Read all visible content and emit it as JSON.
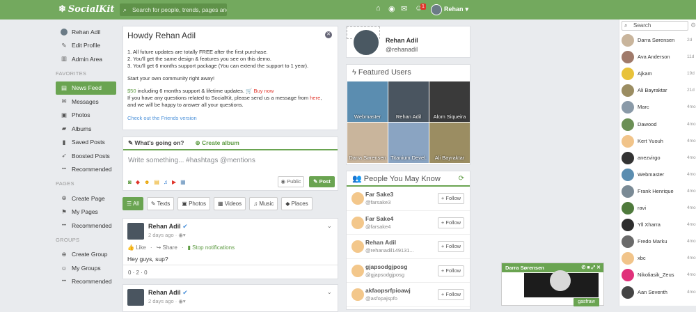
{
  "topbar": {
    "logo": "SocialKit",
    "search_placeholder": "Search for people, trends, pages and...",
    "notif_count": "1",
    "username": "Rehan"
  },
  "sidebar": {
    "user_items": [
      {
        "icon": "avatar",
        "label": "Rehan Adil"
      },
      {
        "icon": "pencil-icon",
        "label": "Edit Profile"
      },
      {
        "icon": "chart-icon",
        "label": "Admin Area"
      }
    ],
    "favorites_title": "FAVORITES",
    "favorites": [
      {
        "icon": "newsfeed-icon",
        "label": "News Feed",
        "active": true
      },
      {
        "icon": "comments-icon",
        "label": "Messages"
      },
      {
        "icon": "photo-icon",
        "label": "Photos"
      },
      {
        "icon": "folder-icon",
        "label": "Albums"
      },
      {
        "icon": "bookmark-icon",
        "label": "Saved Posts"
      },
      {
        "icon": "rocket-icon",
        "label": "Boosted Posts"
      },
      {
        "icon": "dots-icon",
        "label": "Recommended"
      }
    ],
    "pages_title": "PAGES",
    "pages": [
      {
        "icon": "plus-icon",
        "label": "Create Page"
      },
      {
        "icon": "flag-icon",
        "label": "My Pages"
      },
      {
        "icon": "dots-icon",
        "label": "Recommended"
      }
    ],
    "groups_title": "GROUPS",
    "groups": [
      {
        "icon": "plus-icon",
        "label": "Create Group"
      },
      {
        "icon": "users-icon",
        "label": "My Groups"
      },
      {
        "icon": "dots-icon",
        "label": "Recommended"
      }
    ]
  },
  "welcome": {
    "title": "Howdy Rehan Adil",
    "line1": "1. All future updates are totally FREE after the first purchase.",
    "line2": "2. You'll get the same design & features you see on this demo.",
    "line3": "3. You'll get 6 months support package (You can extend the support to 1 year).",
    "line4": "Start your own community right away!",
    "price": "$50",
    "price_text": " including 6 months support & lifetime updates. ",
    "buy": "Buy now",
    "q1": "If you have any questions related to SocialKit, please send us a message from ",
    "here": "here",
    "q1_end": ",",
    "q2": "and we will be happy to answer all your questions.",
    "friends_link": "Check out the Friends version"
  },
  "composer": {
    "tab_status": "What's going on?",
    "tab_album": "Create album",
    "placeholder": "Write something... #hashtags @mentions",
    "privacy": "Public",
    "post": "Post"
  },
  "filters": [
    "All",
    "Texts",
    "Photos",
    "Videos",
    "Music",
    "Places"
  ],
  "post": {
    "author": "Rehan Adil",
    "time": "2 days ago · ",
    "like": "Like",
    "share": "Share",
    "stop": "Stop notifications",
    "text": "Hey guys, sup?",
    "stats": "0 · 2 · 0"
  },
  "post2": {
    "author": "Rehan Adil",
    "time": "2 days ago · "
  },
  "profile": {
    "name": "Rehan Adil",
    "handle": "@rehanadil"
  },
  "featured": {
    "title": "Featured Users",
    "users": [
      {
        "name": "Webmaster",
        "color": "#5b8db0"
      },
      {
        "name": "Rehan Adil",
        "color": "#4a5560"
      },
      {
        "name": "Alom Siqueira",
        "color": "#3a3a3a"
      },
      {
        "name": "Darra Sørensen",
        "color": "#c9b59c"
      },
      {
        "name": "Titanium Devel.",
        "color": "#8aa4c2"
      },
      {
        "name": "Ali Bayraktar",
        "color": "#9b8d62"
      }
    ]
  },
  "pymk": {
    "title": "People You May Know",
    "follow": "Follow",
    "people": [
      {
        "name": "Far Sake3",
        "handle": "@farsake3"
      },
      {
        "name": "Far Sake4",
        "handle": "@farsake4"
      },
      {
        "name": "Rehan Adil",
        "handle": "@rehanadil149131..."
      },
      {
        "name": "gjapsodgjposg",
        "handle": "@gjapsodgjposg"
      },
      {
        "name": "akfaopsrfpioawj",
        "handle": "@asfopajspfo"
      }
    ]
  },
  "chat": {
    "search": "Search",
    "contacts": [
      {
        "name": "Darra Sørensen",
        "time": "2d",
        "color": "#c9b59c"
      },
      {
        "name": "Ava Anderson",
        "time": "11d",
        "color": "#a07a6a"
      },
      {
        "name": "Ajkam",
        "time": "19d",
        "color": "#e8c23a"
      },
      {
        "name": "Ali Bayraktar",
        "time": "21d",
        "color": "#9b8d62"
      },
      {
        "name": "Marc",
        "time": "4mo",
        "color": "#8a9aa8"
      },
      {
        "name": "Dawood",
        "time": "4mo",
        "color": "#6b8f55"
      },
      {
        "name": "Kert Yuouh",
        "time": "4mo",
        "color": "#f1c48a"
      },
      {
        "name": "anezvirgo",
        "time": "4mo",
        "color": "#333"
      },
      {
        "name": "Webmaster",
        "time": "4mo",
        "color": "#5b8db0"
      },
      {
        "name": "Frank Henrique",
        "time": "4mo",
        "color": "#7a8a95"
      },
      {
        "name": "ravi",
        "time": "4mo",
        "color": "#4f7a3c"
      },
      {
        "name": "Yll Xharra",
        "time": "4mo",
        "color": "#2e2e2e"
      },
      {
        "name": "Fredo Marku",
        "time": "4mo",
        "color": "#6a6a6a"
      },
      {
        "name": "xbc",
        "time": "4mo",
        "color": "#f1c48a"
      },
      {
        "name": "Nikoliasik_Zeus",
        "time": "4mo",
        "color": "#e0307a"
      },
      {
        "name": "Aan Seventh",
        "time": "4mo",
        "color": "#444"
      }
    ]
  },
  "popup": {
    "name": "Darra Sørensen",
    "sender": "gasfraw"
  }
}
